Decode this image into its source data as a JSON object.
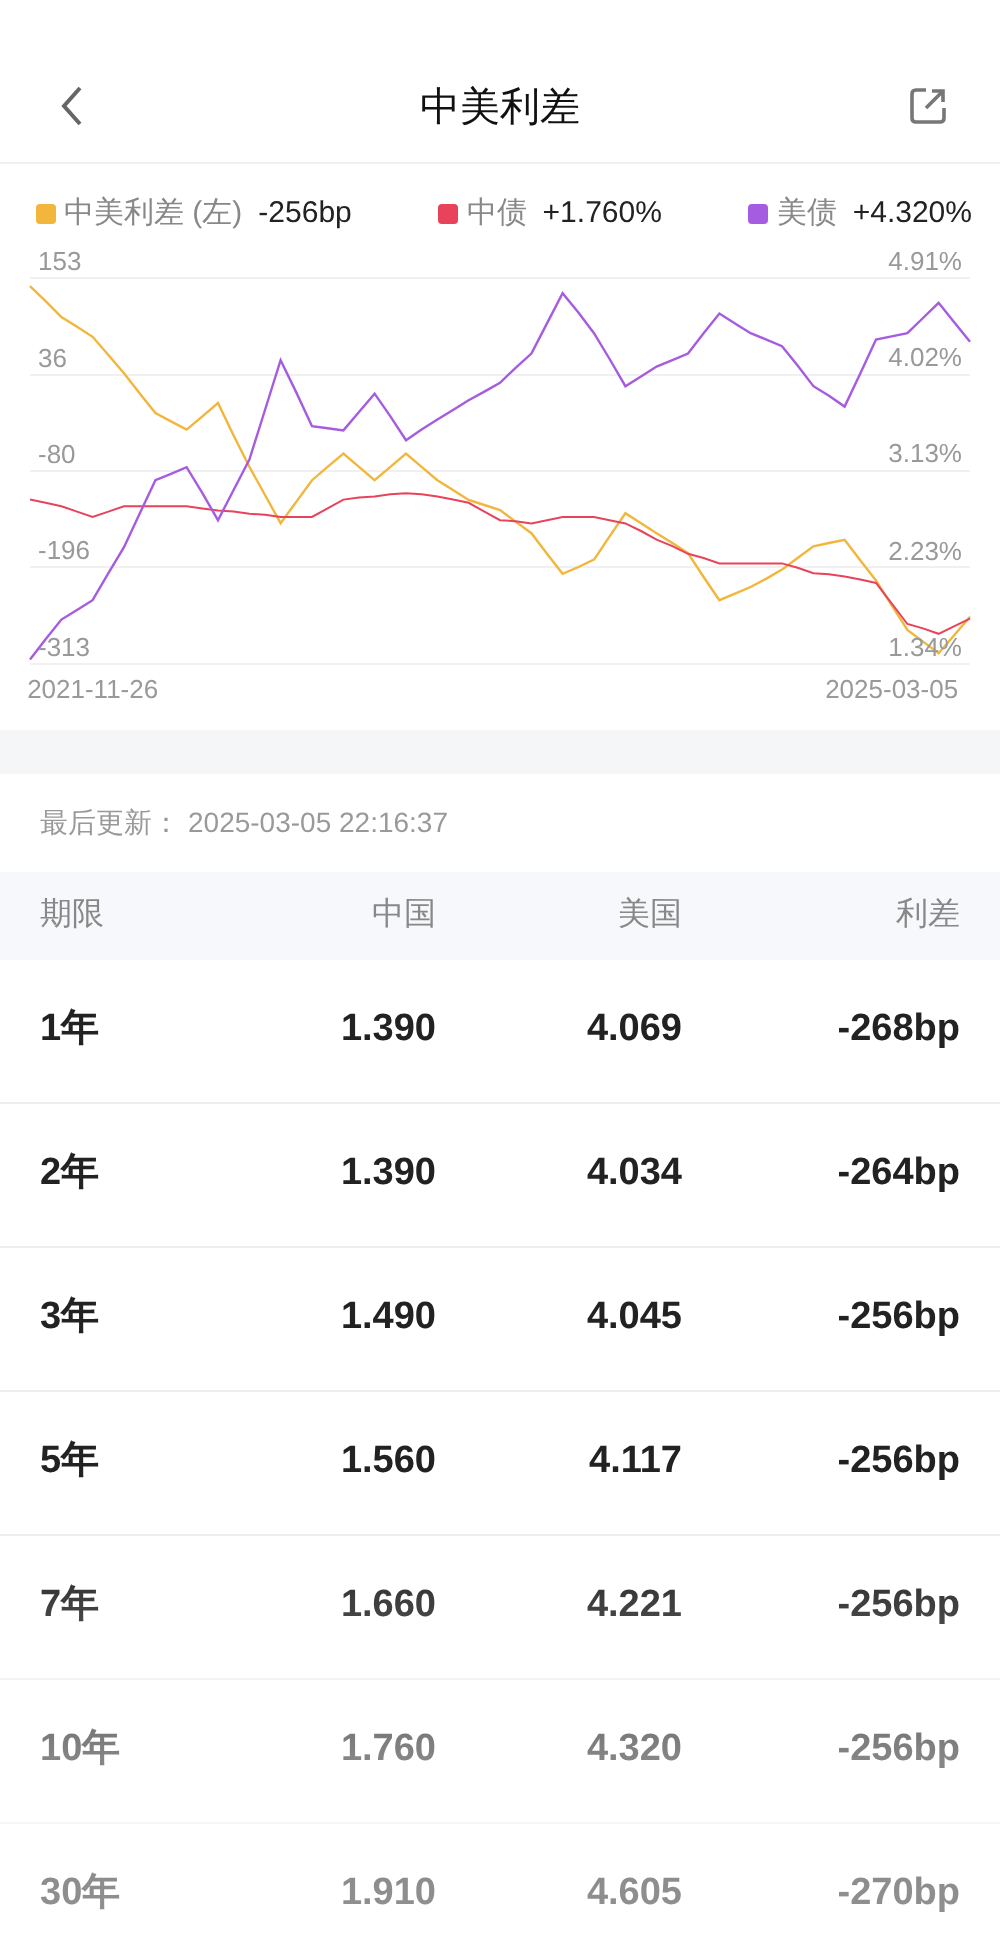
{
  "header": {
    "title": "中美利差"
  },
  "legend": [
    {
      "value": "-256bp"
    },
    {
      "value": "+1.760%"
    },
    {
      "value": "+4.320%"
    }
  ],
  "chart_data": {
    "type": "line",
    "categories": [
      null,
      null,
      null,
      null,
      "2021-11-26",
      null,
      null,
      null,
      null,
      null,
      null,
      null,
      null,
      null,
      null,
      null,
      null,
      null,
      null,
      null,
      null,
      null,
      null,
      null,
      null,
      null,
      null,
      null,
      null,
      null,
      null,
      null,
      null,
      null,
      null,
      null,
      null,
      null,
      null,
      null,
      null,
      null,
      null,
      null,
      null,
      null,
      null,
      null,
      null,
      null,
      null,
      null,
      null,
      null,
      null,
      "2025-03-05",
      null,
      null,
      null,
      null,
      null
    ],
    "grid": true,
    "ylim": [
      -313,
      153
    ],
    "yticks": [
      153,
      36,
      -80,
      -196,
      -313
    ],
    "y2lim": [
      1.34,
      4.91
    ],
    "y2ticks": [
      {
        "value": 4.91,
        "label": "4.91%"
      },
      {
        "value": 4.02,
        "label": "4.02%"
      },
      {
        "value": 3.13,
        "label": "3.13%"
      },
      {
        "value": 2.23,
        "label": "2.23%"
      },
      {
        "value": 1.34,
        "label": "1.34%"
      }
    ],
    "series": [
      {
        "name": "中美利差 (左)",
        "color": "#f2b63c",
        "axis": "y",
        "values": [
          143,
          125,
          106,
          94,
          82,
          60,
          38,
          14,
          -10,
          -20,
          -30,
          -14,
          2,
          -37,
          -75,
          -109,
          -143,
          -117,
          -91,
          -75,
          -59,
          -75,
          -91,
          -75,
          -59,
          -75,
          -91,
          -103,
          -115,
          -121,
          -127,
          -141,
          -155,
          -180,
          -204,
          -196,
          -187,
          -159,
          -131,
          -143,
          -155,
          -167,
          -179,
          -208,
          -236,
          -228,
          -220,
          -210,
          -199,
          -185,
          -171,
          -167,
          -163,
          -188,
          -212,
          -242,
          -272,
          -286,
          -300,
          -278,
          -256
        ]
      },
      {
        "name": "中债",
        "color": "#e8435a",
        "axis": "y2",
        "values": [
          2.86,
          2.83,
          2.8,
          2.75,
          2.7,
          2.75,
          2.8,
          2.8,
          2.8,
          2.8,
          2.8,
          2.78,
          2.76,
          2.75,
          2.73,
          2.72,
          2.7,
          2.7,
          2.7,
          2.78,
          2.86,
          2.88,
          2.89,
          2.91,
          2.92,
          2.91,
          2.89,
          2.86,
          2.83,
          2.75,
          2.67,
          2.66,
          2.64,
          2.67,
          2.7,
          2.7,
          2.7,
          2.67,
          2.64,
          2.57,
          2.49,
          2.43,
          2.36,
          2.32,
          2.27,
          2.27,
          2.27,
          2.27,
          2.27,
          2.23,
          2.18,
          2.17,
          2.15,
          2.12,
          2.09,
          1.9,
          1.71,
          1.67,
          1.62,
          1.69,
          1.76
        ]
      },
      {
        "name": "美债",
        "color": "#a55ce0",
        "axis": "y2",
        "values": [
          1.38,
          1.57,
          1.75,
          1.84,
          1.93,
          2.18,
          2.42,
          2.73,
          3.04,
          3.1,
          3.16,
          2.92,
          2.67,
          2.95,
          3.23,
          3.69,
          4.15,
          3.85,
          3.54,
          3.52,
          3.5,
          3.67,
          3.84,
          3.63,
          3.41,
          3.51,
          3.6,
          3.69,
          3.78,
          3.86,
          3.94,
          4.08,
          4.21,
          4.49,
          4.77,
          4.59,
          4.4,
          4.16,
          3.91,
          4.0,
          4.09,
          4.15,
          4.21,
          4.4,
          4.58,
          4.49,
          4.4,
          4.34,
          4.28,
          4.1,
          3.91,
          3.82,
          3.72,
          4.03,
          4.34,
          4.37,
          4.4,
          4.54,
          4.68,
          4.5,
          4.32
        ]
      }
    ]
  },
  "update": {
    "label": "最后更新：",
    "time": "2025-03-05 22:16:37"
  },
  "table": {
    "columns": [
      "期限",
      "中国",
      "美国",
      "利差"
    ],
    "rows": [
      [
        "1年",
        "1.390",
        "4.069",
        "-268bp"
      ],
      [
        "2年",
        "1.390",
        "4.034",
        "-264bp"
      ],
      [
        "3年",
        "1.490",
        "4.045",
        "-256bp"
      ],
      [
        "5年",
        "1.560",
        "4.117",
        "-256bp"
      ],
      [
        "7年",
        "1.660",
        "4.221",
        "-256bp"
      ],
      [
        "10年",
        "1.760",
        "4.320",
        "-256bp"
      ],
      [
        "30年",
        "1.910",
        "4.605",
        "-270bp"
      ]
    ]
  }
}
